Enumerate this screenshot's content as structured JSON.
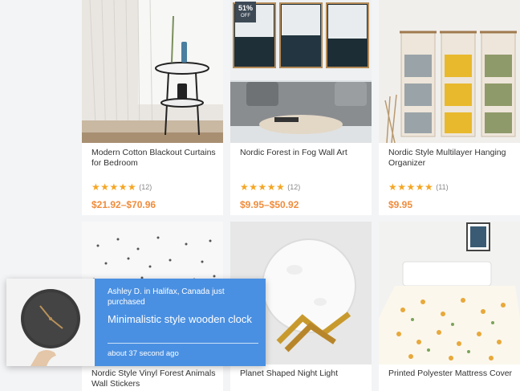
{
  "products": [
    {
      "title": "Modern Cotton Blackout Curtains for Bedroom",
      "stars": "★★★★★",
      "reviews": "(12)",
      "price": "$21.92–$70.96"
    },
    {
      "title": "Nordic Forest in Fog Wall Art",
      "stars": "★★★★★",
      "reviews": "(12)",
      "price": "$9.95–$50.92",
      "badge_pct": "51%",
      "badge_off": "OFF"
    },
    {
      "title": "Nordic Style Multilayer Hanging Organizer",
      "stars": "★★★★★",
      "reviews": "(11)",
      "price": "$9.95"
    },
    {
      "title": "Nordic Style Vinyl Forest Animals Wall Stickers"
    },
    {
      "title": "Planet Shaped Night Light"
    },
    {
      "title": "Printed Polyester Mattress Cover"
    }
  ],
  "notification": {
    "buyer": "Ashley D. in Halifax, Canada just purchased",
    "product": "Minimalistic style wooden clock",
    "time": "about 37 second ago"
  }
}
